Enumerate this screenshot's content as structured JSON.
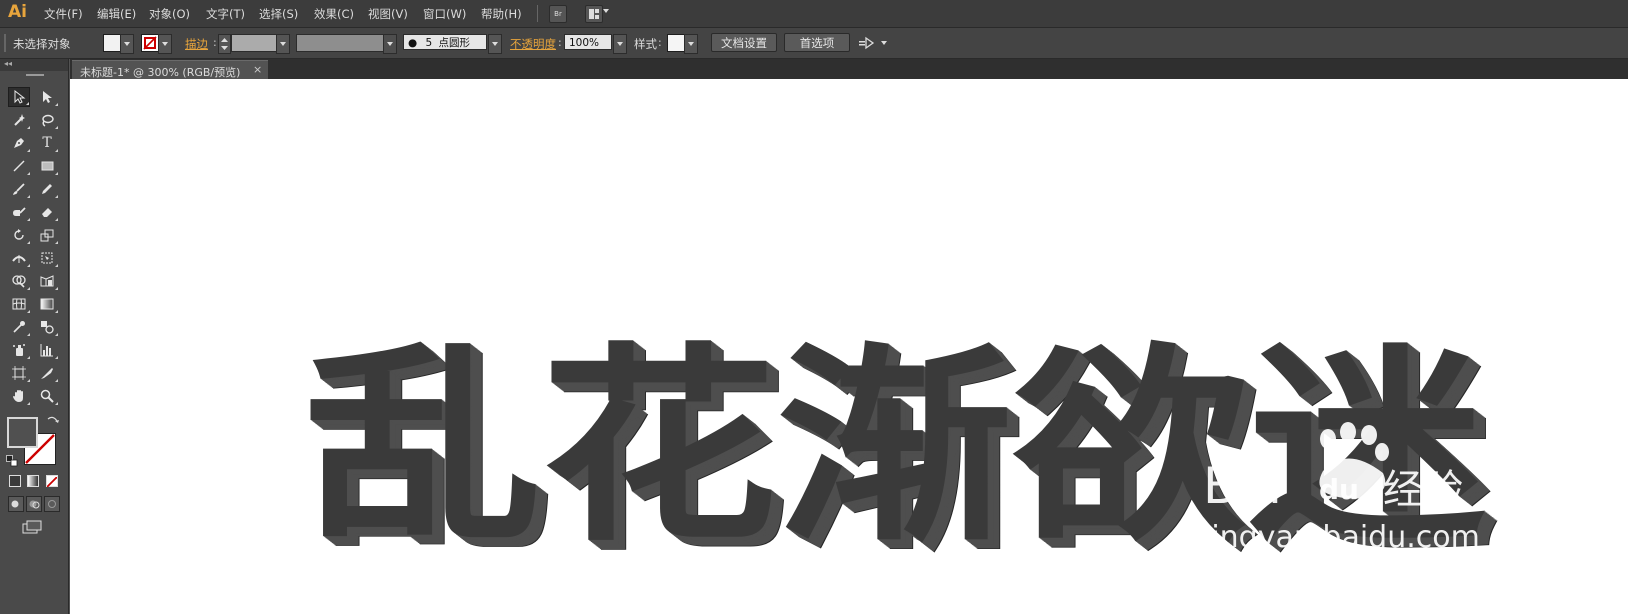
{
  "app": {
    "logo": "Ai",
    "accent": "#e8a53c"
  },
  "menu": [
    "文件(F)",
    "编辑(E)",
    "对象(O)",
    "文字(T)",
    "选择(S)",
    "效果(C)",
    "视图(V)",
    "窗口(W)",
    "帮助(H)"
  ],
  "menu_buttons": {
    "bridge_label": "Br"
  },
  "control": {
    "selection_status": "未选择对象",
    "stroke_label": "描边",
    "brush_size": "5",
    "brush_shape": "点圆形",
    "opacity_label": "不透明度",
    "opacity_value": "100%",
    "style_label": "样式",
    "doc_setup_button": "文档设置",
    "preferences_button": "首选项"
  },
  "document": {
    "tab_title": "未标题-1* @ 300% (RGB/预览)",
    "tab_close": "×"
  },
  "artwork": {
    "text": "乱花渐欲迷",
    "face_color": "#3a3a3a",
    "extrude_color": "#262626",
    "side_color": "#4e4e4e"
  },
  "watermark": {
    "brand_latin": "Bai",
    "brand_du": "du",
    "brand_cn": "经验",
    "url": "jingyan.baidu.com"
  },
  "toolbar": {
    "collapse_glyph": "◂◂",
    "tools": [
      "selection-tool",
      "direct-selection-tool",
      "magic-wand-tool",
      "lasso-tool",
      "pen-tool",
      "type-tool",
      "line-segment-tool",
      "rectangle-tool",
      "paintbrush-tool",
      "pencil-tool",
      "blob-brush-tool",
      "eraser-tool",
      "rotate-tool",
      "scale-tool",
      "width-tool",
      "free-transform-tool",
      "shape-builder-tool",
      "perspective-grid-tool",
      "mesh-tool",
      "gradient-tool",
      "eyedropper-tool",
      "blend-tool",
      "symbol-sprayer-tool",
      "column-graph-tool",
      "artboard-tool",
      "slice-tool",
      "hand-tool",
      "zoom-tool"
    ],
    "type_tool_glyph": "T"
  }
}
